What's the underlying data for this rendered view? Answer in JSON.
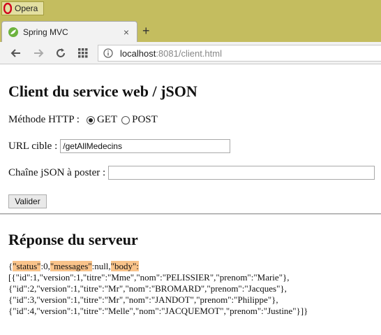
{
  "os": {
    "app_label": "Opera"
  },
  "browser": {
    "tab_title": "Spring MVC",
    "tab_close": "×",
    "new_tab": "+",
    "url_host": "localhost",
    "url_rest": ":8081/client.html"
  },
  "page": {
    "heading": "Client du service web / jSON",
    "method_label": "Méthode HTTP :",
    "method_options": [
      "GET",
      "POST"
    ],
    "selected_method": "GET",
    "url_label": "URL cible :",
    "url_value": "/getAllMedecins",
    "json_label": "Chaîne jSON à poster :",
    "json_value": "",
    "submit_label": "Valider",
    "response_heading": "Réponse du serveur",
    "response": {
      "open": "{",
      "status_key": "\"status\"",
      "status_rest": ":0,",
      "messages_key": "\"messages\"",
      "messages_rest": ":null,",
      "body_key": "\"body\":",
      "lines": [
        "[{\"id\":1,\"version\":1,\"titre\":\"Mme\",\"nom\":\"PELISSIER\",\"prenom\":\"Marie\"},",
        "{\"id\":2,\"version\":1,\"titre\":\"Mr\",\"nom\":\"BROMARD\",\"prenom\":\"Jacques\"},",
        "{\"id\":3,\"version\":1,\"titre\":\"Mr\",\"nom\":\"JANDOT\",\"prenom\":\"Philippe\"},",
        "{\"id\":4,\"version\":1,\"titre\":\"Melle\",\"nom\":\"JACQUEMOT\",\"prenom\":\"Justine\"}]}"
      ]
    }
  }
}
